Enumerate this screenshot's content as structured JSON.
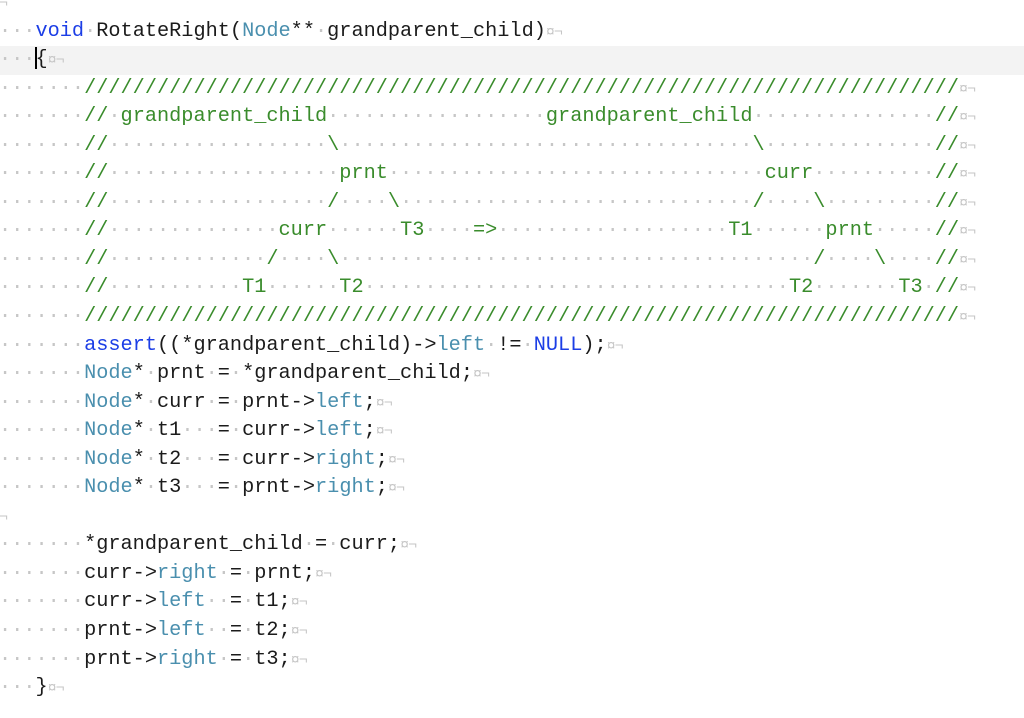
{
  "editor": {
    "current_line": 2,
    "caret_line": 2,
    "colors": {
      "keyword": "#1c3ee6",
      "type": "#4a8fae",
      "member": "#4a8fae",
      "comment": "#3a8c2c",
      "plain": "#1b1b1b",
      "invisibles": "#c6c6c6",
      "current_line_bg": "#f3f3f3"
    },
    "invisibles": {
      "space": "·",
      "eol": "¤¬",
      "empty_eol": "¬"
    },
    "lines": [
      {
        "tokens": [],
        "eol": "¬"
      },
      {
        "tokens": [
          [
            "   ",
            "plain"
          ],
          [
            "void",
            "keyword"
          ],
          [
            " RotateRight(",
            "plain"
          ],
          [
            "Node",
            "type"
          ],
          [
            "** grandparent_child)",
            "plain"
          ]
        ],
        "eol": "¤¬"
      },
      {
        "tokens": [
          [
            "   ",
            "plain"
          ],
          [
            "{",
            "plain"
          ]
        ],
        "eol": "¤¬",
        "caret": true
      },
      {
        "tokens": [
          [
            "       ",
            "plain"
          ],
          [
            "////////////////////////////////////////////////////////////////////////",
            "comment"
          ]
        ],
        "eol": "¤¬"
      },
      {
        "tokens": [
          [
            "       ",
            "plain"
          ],
          [
            "// grandparent_child                  grandparent_child               //",
            "comment"
          ]
        ],
        "eol": "¤¬"
      },
      {
        "tokens": [
          [
            "       ",
            "plain"
          ],
          [
            "//                  \\                                  \\              //",
            "comment"
          ]
        ],
        "eol": "¤¬"
      },
      {
        "tokens": [
          [
            "       ",
            "plain"
          ],
          [
            "//                   prnt                               curr          //",
            "comment"
          ]
        ],
        "eol": "¤¬"
      },
      {
        "tokens": [
          [
            "       ",
            "plain"
          ],
          [
            "//                  /    \\                             /    \\         //",
            "comment"
          ]
        ],
        "eol": "¤¬"
      },
      {
        "tokens": [
          [
            "       ",
            "plain"
          ],
          [
            "//              curr      T3    =>                   T1      prnt     //",
            "comment"
          ]
        ],
        "eol": "¤¬"
      },
      {
        "tokens": [
          [
            "       ",
            "plain"
          ],
          [
            "//             /    \\                                       /    \\    //",
            "comment"
          ]
        ],
        "eol": "¤¬"
      },
      {
        "tokens": [
          [
            "       ",
            "plain"
          ],
          [
            "//           T1      T2                                   T2       T3 //",
            "comment"
          ]
        ],
        "eol": "¤¬"
      },
      {
        "tokens": [
          [
            "       ",
            "plain"
          ],
          [
            "////////////////////////////////////////////////////////////////////////",
            "comment"
          ]
        ],
        "eol": "¤¬"
      },
      {
        "tokens": [
          [
            "       ",
            "plain"
          ],
          [
            "assert",
            "keyword"
          ],
          [
            "((*grandparent_child)->",
            "plain"
          ],
          [
            "left",
            "member"
          ],
          [
            " != ",
            "plain"
          ],
          [
            "NULL",
            "keyword"
          ],
          [
            ");",
            "plain"
          ]
        ],
        "eol": "¤¬"
      },
      {
        "tokens": [
          [
            "       ",
            "plain"
          ],
          [
            "Node",
            "type"
          ],
          [
            "* prnt = *grandparent_child;",
            "plain"
          ]
        ],
        "eol": "¤¬"
      },
      {
        "tokens": [
          [
            "       ",
            "plain"
          ],
          [
            "Node",
            "type"
          ],
          [
            "* curr = prnt->",
            "plain"
          ],
          [
            "left",
            "member"
          ],
          [
            ";",
            "plain"
          ]
        ],
        "eol": "¤¬"
      },
      {
        "tokens": [
          [
            "       ",
            "plain"
          ],
          [
            "Node",
            "type"
          ],
          [
            "* t1   = curr->",
            "plain"
          ],
          [
            "left",
            "member"
          ],
          [
            ";",
            "plain"
          ]
        ],
        "eol": "¤¬"
      },
      {
        "tokens": [
          [
            "       ",
            "plain"
          ],
          [
            "Node",
            "type"
          ],
          [
            "* t2   = curr->",
            "plain"
          ],
          [
            "right",
            "member"
          ],
          [
            ";",
            "plain"
          ]
        ],
        "eol": "¤¬"
      },
      {
        "tokens": [
          [
            "       ",
            "plain"
          ],
          [
            "Node",
            "type"
          ],
          [
            "* t3   = prnt->",
            "plain"
          ],
          [
            "right",
            "member"
          ],
          [
            ";",
            "plain"
          ]
        ],
        "eol": "¤¬"
      },
      {
        "tokens": [],
        "eol": "¬"
      },
      {
        "tokens": [
          [
            "       ",
            "plain"
          ],
          [
            "*grandparent_child = curr;",
            "plain"
          ]
        ],
        "eol": "¤¬"
      },
      {
        "tokens": [
          [
            "       ",
            "plain"
          ],
          [
            "curr->",
            "plain"
          ],
          [
            "right",
            "member"
          ],
          [
            " = prnt;",
            "plain"
          ]
        ],
        "eol": "¤¬"
      },
      {
        "tokens": [
          [
            "       ",
            "plain"
          ],
          [
            "curr->",
            "plain"
          ],
          [
            "left",
            "member"
          ],
          [
            "  = t1;",
            "plain"
          ]
        ],
        "eol": "¤¬"
      },
      {
        "tokens": [
          [
            "       ",
            "plain"
          ],
          [
            "prnt->",
            "plain"
          ],
          [
            "left",
            "member"
          ],
          [
            "  = t2;",
            "plain"
          ]
        ],
        "eol": "¤¬"
      },
      {
        "tokens": [
          [
            "       ",
            "plain"
          ],
          [
            "prnt->",
            "plain"
          ],
          [
            "right",
            "member"
          ],
          [
            " = t3;",
            "plain"
          ]
        ],
        "eol": "¤¬"
      },
      {
        "tokens": [
          [
            "   ",
            "plain"
          ],
          [
            "}",
            "plain"
          ]
        ],
        "eol": "¤¬"
      }
    ]
  }
}
